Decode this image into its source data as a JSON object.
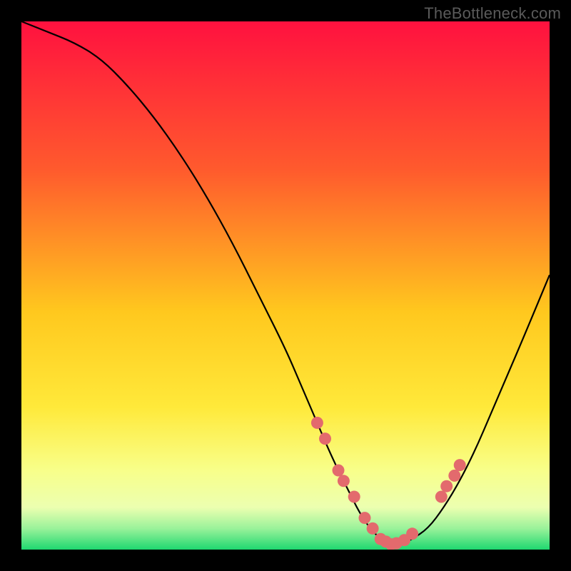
{
  "watermark": "TheBottleneck.com",
  "colors": {
    "bg_black": "#000000",
    "grad_top": "#ff113f",
    "grad_mid1": "#ff6a2a",
    "grad_mid2": "#ffd91a",
    "grad_mid3": "#fff36b",
    "grad_low": "#f6ffb0",
    "grad_green": "#2fe27a",
    "curve_stroke": "#000000",
    "marker_fill": "#e36a6d",
    "marker_stroke": "#b94d50"
  },
  "chart_data": {
    "type": "line",
    "title": "",
    "xlabel": "",
    "ylabel": "",
    "x": [
      0,
      5,
      10,
      15,
      20,
      25,
      30,
      35,
      40,
      45,
      50,
      53,
      56,
      59,
      62,
      64,
      66,
      68,
      70,
      72,
      74,
      77,
      80,
      83,
      86,
      89,
      92,
      95,
      100
    ],
    "values": [
      100,
      98,
      96,
      93,
      88,
      82,
      75,
      67,
      58,
      48,
      38,
      31,
      24,
      17,
      11,
      7,
      4,
      2,
      1,
      1,
      2,
      4,
      8,
      13,
      19,
      26,
      33,
      40,
      52
    ],
    "xlim": [
      0,
      100
    ],
    "ylim": [
      0,
      100
    ],
    "markers": {
      "x": [
        56,
        57.5,
        60,
        61,
        63,
        65,
        66.5,
        68,
        69,
        70,
        71,
        72.5,
        74,
        79.5,
        80.5,
        82,
        83
      ],
      "y": [
        24,
        21,
        15,
        13,
        10,
        6,
        4,
        2,
        1.5,
        1,
        1.2,
        1.8,
        3,
        10,
        12,
        14,
        16
      ]
    },
    "gradient_stops": [
      {
        "offset": 0.0,
        "color": "#ff113f"
      },
      {
        "offset": 0.28,
        "color": "#ff5a2d"
      },
      {
        "offset": 0.55,
        "color": "#ffc81e"
      },
      {
        "offset": 0.73,
        "color": "#ffe93a"
      },
      {
        "offset": 0.85,
        "color": "#f8ff8a"
      },
      {
        "offset": 0.92,
        "color": "#ecffb0"
      },
      {
        "offset": 0.96,
        "color": "#9af29a"
      },
      {
        "offset": 1.0,
        "color": "#1fd870"
      }
    ]
  }
}
